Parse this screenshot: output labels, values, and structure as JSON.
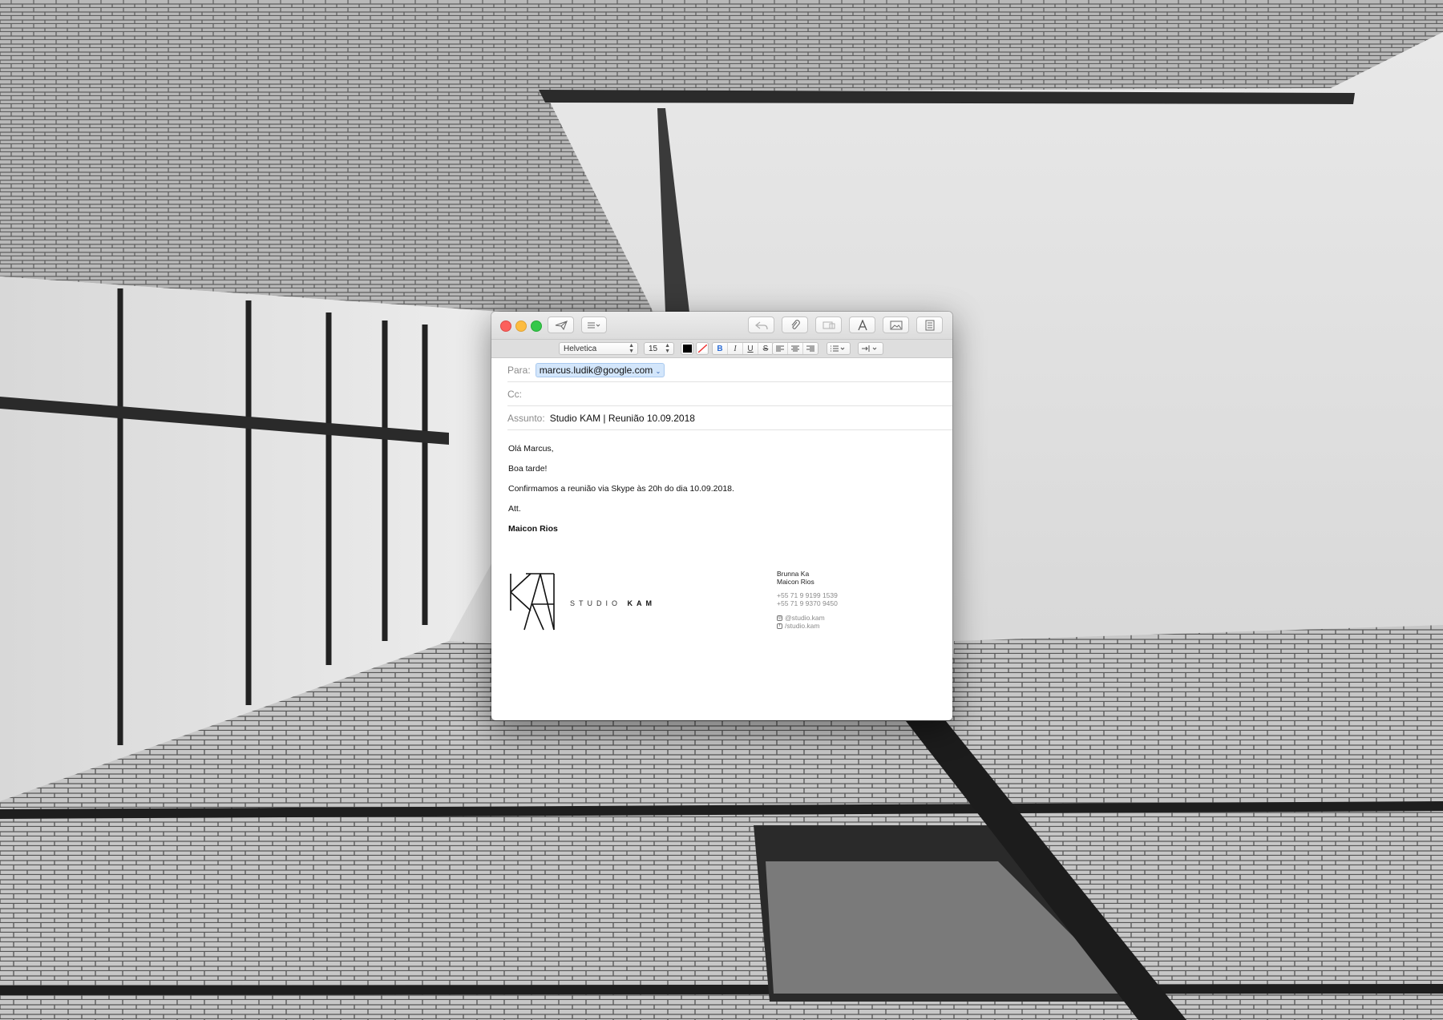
{
  "compose": {
    "toolbar": {
      "send_icon": "paper-plane-icon",
      "header_fields_icon": "list-icon",
      "reply_icon": "reply-arrow-icon",
      "attach_icon": "paperclip-icon",
      "photo_browser_icon": "photo-browser-icon",
      "format_icon": "font-a-icon",
      "image_icon": "image-icon",
      "stationery_icon": "document-icon"
    },
    "formatbar": {
      "font": "Helvetica",
      "size": "15",
      "bold": "B",
      "italic": "I",
      "underline": "U",
      "strike": "S",
      "text_color": "#000000"
    },
    "to_label": "Para:",
    "to_value": "marcus.ludik@google.com",
    "cc_label": "Cc:",
    "subject_label": "Assunto:",
    "subject_value": "Studio KAM | Reunião 10.09.2018",
    "body": [
      "Olá Marcus,",
      "Boa tarde!",
      "Confirmamos a reunião via Skype às 20h do dia 10.09.2018.",
      "Att."
    ],
    "sender_name": "Maicon Rios",
    "signature": {
      "studio": "STUDIO",
      "studio_bold": "KAM",
      "names": [
        "Brunna Ka",
        "Maicon Rios"
      ],
      "phones": [
        "+55 71 9 9199 1539",
        "+55 71 9 9370 9450"
      ],
      "instagram": "@studio.kam",
      "facebook": "/studio.kam"
    }
  }
}
